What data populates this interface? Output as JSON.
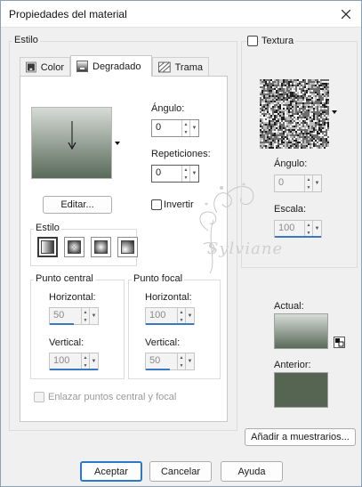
{
  "window": {
    "title": "Propiedades del material"
  },
  "estilo_group": {
    "label": "Estilo"
  },
  "tabs": [
    {
      "label": "Color"
    },
    {
      "label": "Degradado"
    },
    {
      "label": "Trama"
    }
  ],
  "gradient": {
    "angle_label": "Ángulo:",
    "angle_value": "0",
    "reps_label": "Repeticiones:",
    "reps_value": "0",
    "edit_label": "Editar...",
    "invert_label": "Invertir",
    "style_label": "Estilo",
    "styles": [
      "linear",
      "rectangular",
      "sunburst",
      "radial"
    ],
    "central_label": "Punto central",
    "focal_label": "Punto focal",
    "central_h_label": "Horizontal:",
    "central_h_value": "50",
    "central_v_label": "Vertical:",
    "central_v_value": "100",
    "focal_h_label": "Horizontal:",
    "focal_h_value": "100",
    "focal_v_label": "Vertical:",
    "focal_v_value": "50",
    "link_label": "Enlazar puntos central y focal",
    "colors": {
      "top": "#d6dbd6",
      "bottom": "#596a5a"
    }
  },
  "texture": {
    "label": "Textura",
    "angle_label": "Ángulo:",
    "angle_value": "0",
    "scale_label": "Escala:",
    "scale_value": "100"
  },
  "watermark": {
    "text": "Sylviane"
  },
  "actual": {
    "label": "Actual:"
  },
  "anterior": {
    "label": "Anterior:",
    "color": "#566452"
  },
  "swatches_button": "Añadir a muestrarios...",
  "footer": {
    "accept": "Aceptar",
    "cancel": "Cancelar",
    "help": "Ayuda"
  }
}
